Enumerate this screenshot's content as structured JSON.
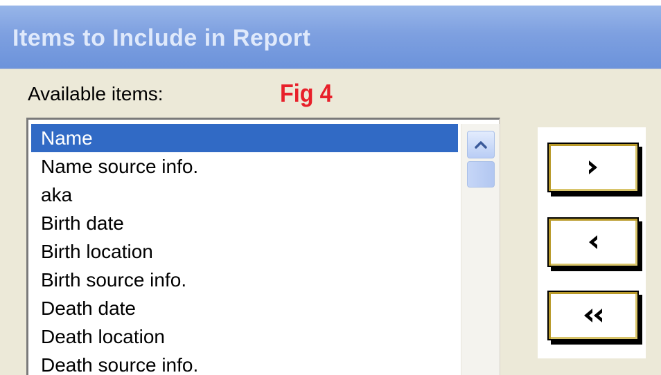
{
  "dialog": {
    "title": "Items to Include in Report",
    "available_label": "Available items:",
    "figure_label": "Fig 4"
  },
  "available_items": [
    {
      "label": "Name",
      "selected": true
    },
    {
      "label": "Name source info.",
      "selected": false
    },
    {
      "label": "aka",
      "selected": false
    },
    {
      "label": "Birth date",
      "selected": false
    },
    {
      "label": "Birth location",
      "selected": false
    },
    {
      "label": "Birth source info.",
      "selected": false
    },
    {
      "label": "Death date",
      "selected": false
    },
    {
      "label": "Death location",
      "selected": false
    },
    {
      "label": "Death source info.",
      "selected": false
    }
  ],
  "buttons": [
    {
      "name": "add-item-button",
      "icon": "chevron-right-icon"
    },
    {
      "name": "remove-item-button",
      "icon": "chevron-left-icon"
    },
    {
      "name": "remove-all-button",
      "icon": "double-chevron-left-icon"
    }
  ],
  "scrollbar": {
    "up_icon": "chevron-up-icon"
  },
  "colors": {
    "title_bar": "#7ea0e0",
    "title_text": "#dfe9fb",
    "selection": "#316ac5",
    "figure_label": "#e8202a",
    "dialog_background": "#ece9d8"
  }
}
